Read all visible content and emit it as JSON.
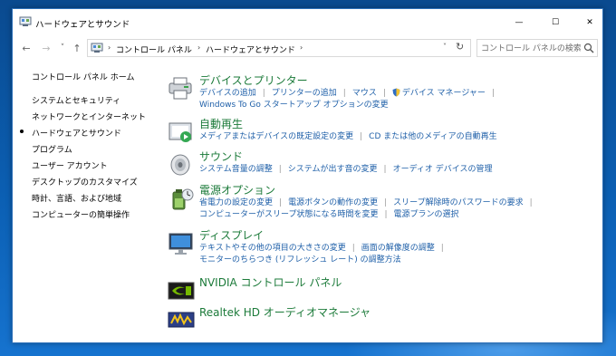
{
  "window": {
    "title": "ハードウェアとサウンド",
    "min_glyph": "—",
    "max_glyph": "☐",
    "close_glyph": "✕"
  },
  "nav": {
    "back_glyph": "←",
    "forward_glyph": "→",
    "recent_glyph": "˅",
    "up_glyph": "↑"
  },
  "address": {
    "crumbs": [
      "コントロール パネル",
      "ハードウェアとサウンド"
    ],
    "separator": "›",
    "dropdown_glyph": "˅",
    "refresh_glyph": "↻"
  },
  "search": {
    "placeholder": "コントロール パネルの検索"
  },
  "sidebar": {
    "home": "コントロール パネル ホーム",
    "items": [
      {
        "label": "システムとセキュリティ"
      },
      {
        "label": "ネットワークとインターネット"
      },
      {
        "label": "ハードウェアとサウンド",
        "selected": true
      },
      {
        "label": "プログラム"
      },
      {
        "label": "ユーザー アカウント"
      },
      {
        "label": "デスクトップのカスタマイズ"
      },
      {
        "label": "時計、言語、および地域"
      },
      {
        "label": "コンピューターの簡単操作"
      }
    ]
  },
  "categories": [
    {
      "title": "デバイスとプリンター",
      "icon": "printer-icon",
      "rows": [
        [
          "デバイスの追加",
          "プリンターの追加",
          "マウス",
          "デバイス マネージャー"
        ],
        [
          "Windows To Go スタートアップ オプションの変更"
        ]
      ]
    },
    {
      "title": "自動再生",
      "icon": "autoplay-icon",
      "rows": [
        [
          "メディアまたはデバイスの既定設定の変更",
          "CD または他のメディアの自動再生"
        ]
      ]
    },
    {
      "title": "サウンド",
      "icon": "speaker-icon",
      "rows": [
        [
          "システム音量の調整",
          "システムが出す音の変更",
          "オーディオ デバイスの管理"
        ]
      ]
    },
    {
      "title": "電源オプション",
      "icon": "power-options-icon",
      "rows": [
        [
          "省電力の設定の変更",
          "電源ボタンの動作の変更",
          "スリープ解除時のパスワードの要求"
        ],
        [
          "コンピューターがスリープ状態になる時間を変更",
          "電源プランの選択"
        ]
      ]
    },
    {
      "title": "ディスプレイ",
      "icon": "display-icon",
      "rows": [
        [
          "テキストやその他の項目の大きさの変更",
          "画面の解像度の調整"
        ],
        [
          "モニターのちらつき (リフレッシュ レート) の調整方法"
        ]
      ]
    },
    {
      "title": "NVIDIA コントロール パネル",
      "icon": "nvidia-icon",
      "rows": []
    },
    {
      "title": "Realtek HD オーディオマネージャ",
      "icon": "realtek-icon",
      "rows": []
    }
  ],
  "colors": {
    "category_title": "#1b7a39",
    "link": "#1e5fa8",
    "desktop": "#0b5fb3"
  }
}
